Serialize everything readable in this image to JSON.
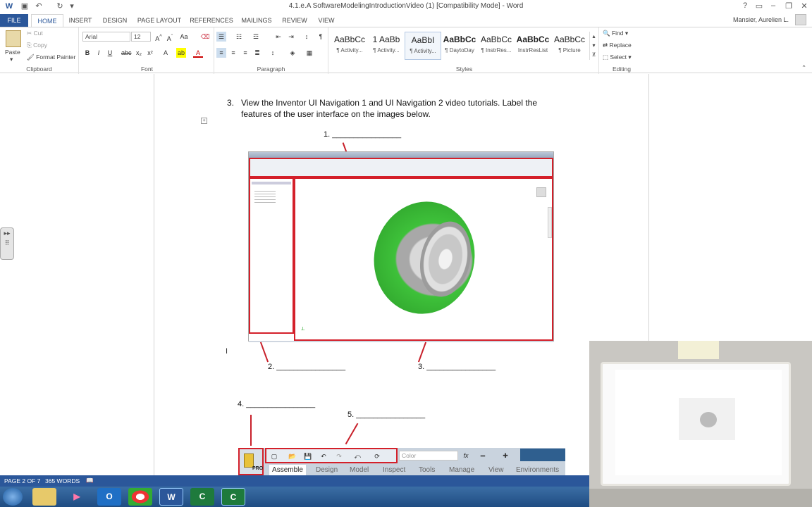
{
  "window": {
    "title": "4.1.e.A SoftwareModelingIntroductionVideo (1) [Compatibility Mode] - Word",
    "help": "?",
    "user": "Mansier, Aurelien L."
  },
  "tabs": [
    "FILE",
    "HOME",
    "INSERT",
    "DESIGN",
    "PAGE LAYOUT",
    "REFERENCES",
    "MAILINGS",
    "REVIEW",
    "VIEW"
  ],
  "clipboard": {
    "paste": "Paste",
    "cut": "Cut",
    "copy": "Copy",
    "format_painter": "Format Painter",
    "label": "Clipboard"
  },
  "font": {
    "name": "Arial",
    "size": "12",
    "label": "Font"
  },
  "paragraph": {
    "label": "Paragraph"
  },
  "styles": {
    "label": "Styles",
    "items": [
      {
        "sample": "AaBbCc",
        "name": "¶ Activity..."
      },
      {
        "sample": "1",
        "name": "¶ Activity..."
      },
      {
        "sample": "AaBbI",
        "name": "¶ Activity..."
      },
      {
        "sample": "AaBbCc",
        "name": "¶ DaytoDay"
      },
      {
        "sample": "AaBbCc",
        "name": "¶ InstrRes..."
      },
      {
        "sample": "AaBbCc",
        "name": "InstrResList"
      },
      {
        "sample": "AaBbCc",
        "name": "¶ Picture"
      }
    ],
    "item2_sample": "AaBbI",
    "item1_sample": "1 AaBb"
  },
  "editing": {
    "find": "Find",
    "replace": "Replace",
    "select": "Select",
    "label": "Editing"
  },
  "document": {
    "q_number": "3.",
    "q_line1": "View the Inventor UI Navigation 1 and UI Navigation 2 video tutorials. Label the",
    "q_line2": "features of the user interface on the images below.",
    "label1": "1.",
    "label2": "2.",
    "label3": "3.",
    "label4": "4.",
    "label5": "5.",
    "blank": "________________"
  },
  "inventor_toolbar": {
    "pro": "PRO",
    "color": "Color",
    "fx": "fx",
    "tabs": [
      "Assemble",
      "Design",
      "Model",
      "Inspect",
      "Tools",
      "Manage",
      "View",
      "Environments"
    ]
  },
  "status": {
    "page": "PAGE 2 OF 7",
    "words": "365 WORDS"
  },
  "colors": {
    "word_blue": "#2b579a",
    "red": "#d4202a",
    "green": "#3ec13a"
  }
}
